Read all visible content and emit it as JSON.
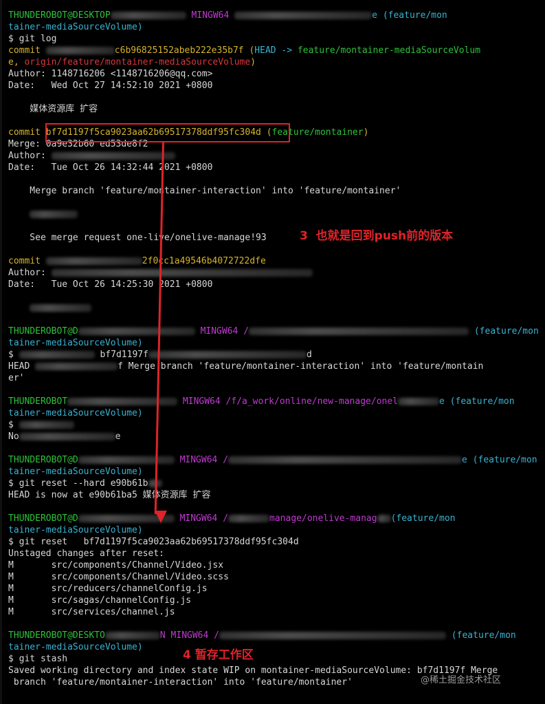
{
  "terminal": {
    "lines": [
      [
        {
          "t": "THUNDEROBOT@DESKTOP",
          "c": "green"
        },
        {
          "blur": 110
        },
        {
          "t": " MINGW64 ",
          "c": "magenta"
        },
        {
          "blur": 200
        },
        {
          "t": "e (feature/mon",
          "c": "cyan"
        }
      ],
      [
        {
          "t": "tainer-mediaSourceVolume)",
          "c": "cyan"
        }
      ],
      [
        {
          "t": "$ git log",
          "c": "white"
        }
      ],
      [
        {
          "t": "commit ",
          "c": "yellow"
        },
        {
          "blur": 100
        },
        {
          "t": "c6b96825152abeb222e35b7f (",
          "c": "yellow"
        },
        {
          "t": "HEAD -> ",
          "c": "cyan"
        },
        {
          "t": "feature/montainer-mediaSourceVolum",
          "c": "green"
        }
      ],
      [
        {
          "t": "e, ",
          "c": "yellow"
        },
        {
          "t": "origin/feature/montainer-mediaSourceVolume",
          "c": "red"
        },
        {
          "t": ")",
          "c": "yellow"
        }
      ],
      [
        {
          "t": "Author: 1148716206 <1148716206@qq.com>",
          "c": "white"
        }
      ],
      [
        {
          "t": "Date:   Wed Oct 27 14:52:10 2021 +0800",
          "c": "white"
        }
      ],
      [
        {
          "t": "",
          "c": "white"
        }
      ],
      [
        {
          "t": "    媒体资源库 扩容",
          "c": "white"
        }
      ],
      [
        {
          "t": "",
          "c": "white"
        }
      ],
      [
        {
          "t": "commit ",
          "c": "yellow"
        },
        {
          "t": "bf7d1197f5ca9023aa62b69517378ddf95fc304d (",
          "c": "yellow"
        },
        {
          "t": "feature/montainer",
          "c": "green"
        },
        {
          "t": ")",
          "c": "yellow"
        }
      ],
      [
        {
          "t": "Merge: 0a9e32b60 ed53de8f2",
          "c": "white"
        }
      ],
      [
        {
          "t": "Author: ",
          "c": "white"
        },
        {
          "blur": 180
        }
      ],
      [
        {
          "t": "Date:   Tue Oct 26 14:32:44 2021 +0800",
          "c": "white"
        }
      ],
      [
        {
          "t": "",
          "c": "white"
        }
      ],
      [
        {
          "t": "    Merge branch 'feature/montainer-interaction' into 'feature/montainer'",
          "c": "white"
        }
      ],
      [
        {
          "t": "",
          "c": "white"
        }
      ],
      [
        {
          "t": "    ",
          "c": "white"
        },
        {
          "blur": 70
        }
      ],
      [
        {
          "t": "",
          "c": "white"
        }
      ],
      [
        {
          "t": "    See merge request one-live/onelive-manage!93",
          "c": "white"
        }
      ],
      [
        {
          "t": "",
          "c": "white"
        }
      ],
      [
        {
          "t": "commit ",
          "c": "yellow"
        },
        {
          "blur": 140
        },
        {
          "t": "2f0cc1a49546b4072722dfe",
          "c": "yellow"
        }
      ],
      [
        {
          "t": "Author: ",
          "c": "white"
        },
        {
          "blur": 380
        }
      ],
      [
        {
          "t": "Date:   Tue Oct 26 14:25:30 2021 +0800",
          "c": "white"
        }
      ],
      [
        {
          "t": "",
          "c": "white"
        }
      ],
      [
        {
          "t": "    ",
          "c": "white"
        },
        {
          "blur": 90
        }
      ],
      [
        {
          "t": "",
          "c": "white"
        }
      ],
      [
        {
          "t": "THUNDEROBOT@D",
          "c": "green"
        },
        {
          "blur": 170
        },
        {
          "t": " MINGW64 /",
          "c": "magenta"
        },
        {
          "blur": 320
        },
        {
          "t": " (feature/mon",
          "c": "cyan"
        }
      ],
      [
        {
          "t": "tainer-mediaSourceVolume)",
          "c": "cyan"
        }
      ],
      [
        {
          "t": "$ ",
          "c": "white"
        },
        {
          "blur": 110
        },
        {
          "t": " bf7d1197f",
          "c": "white"
        },
        {
          "blur": 230
        },
        {
          "t": "d",
          "c": "white"
        }
      ],
      [
        {
          "t": "HEAD ",
          "c": "white"
        },
        {
          "blur": 120
        },
        {
          "t": "f Merge branch 'feature/montainer-interaction' into 'feature/montain",
          "c": "white"
        }
      ],
      [
        {
          "t": "er'",
          "c": "white"
        }
      ],
      [
        {
          "t": "",
          "c": "white"
        }
      ],
      [
        {
          "t": "THUNDEROBOT",
          "c": "green"
        },
        {
          "blur": 160
        },
        {
          "t": " MINGW64 /",
          "c": "magenta"
        },
        {
          "t": "f/a_work/online/new-manage/onel",
          "c": "magenta"
        },
        {
          "blur": 60
        },
        {
          "t": "e (feature/mon",
          "c": "cyan"
        }
      ],
      [
        {
          "t": "tainer-mediaSourceVolume)",
          "c": "cyan"
        }
      ],
      [
        {
          "t": "$ ",
          "c": "white"
        },
        {
          "blur": 80
        }
      ],
      [
        {
          "t": "No",
          "c": "white"
        },
        {
          "blur": 140
        },
        {
          "t": "e",
          "c": "white"
        }
      ],
      [
        {
          "t": "",
          "c": "white"
        }
      ],
      [
        {
          "t": "THUNDEROBOT@D",
          "c": "green"
        },
        {
          "blur": 140
        },
        {
          "t": " MINGW64 /",
          "c": "magenta"
        },
        {
          "blur": 340
        },
        {
          "t": "e (feature/mon",
          "c": "cyan"
        }
      ],
      [
        {
          "t": "tainer-mediaSourceVolume)",
          "c": "cyan"
        }
      ],
      [
        {
          "t": "$ git reset --hard e90b61b",
          "c": "white"
        },
        {
          "blur": 20
        }
      ],
      [
        {
          "t": "HEAD is now at e90b61ba5 媒体资源库 扩容",
          "c": "white"
        }
      ],
      [
        {
          "t": "",
          "c": "white"
        }
      ],
      [
        {
          "t": "THUNDEROBOT@D",
          "c": "green"
        },
        {
          "blur": 140
        },
        {
          "t": " MINGW64 /",
          "c": "magenta"
        },
        {
          "blur": 60
        },
        {
          "t": "manage/onelive-manag",
          "c": "magenta"
        },
        {
          "blur": 20
        },
        {
          "t": "(feature/mon",
          "c": "cyan"
        }
      ],
      [
        {
          "t": "tainer-mediaSourceVolume)",
          "c": "cyan"
        }
      ],
      [
        {
          "t": "$ git reset   bf7d1197f5ca9023aa62b69517378ddf95fc304d",
          "c": "white"
        }
      ],
      [
        {
          "t": "Unstaged changes after reset:",
          "c": "white"
        }
      ],
      [
        {
          "t": "M       src/components/Channel/Video.jsx",
          "c": "white"
        }
      ],
      [
        {
          "t": "M       src/components/Channel/Video.scss",
          "c": "white"
        }
      ],
      [
        {
          "t": "M       src/reducers/channelConfig.js",
          "c": "white"
        }
      ],
      [
        {
          "t": "M       src/sagas/channelConfig.js",
          "c": "white"
        }
      ],
      [
        {
          "t": "M       src/services/channel.js",
          "c": "white"
        }
      ],
      [
        {
          "t": "",
          "c": "white"
        }
      ],
      [
        {
          "t": "THUNDEROBOT@DESKTO",
          "c": "green"
        },
        {
          "blur": 80
        },
        {
          "t": "N MINGW64 /",
          "c": "magenta"
        },
        {
          "blur": 330
        },
        {
          "t": " (feature/mon",
          "c": "cyan"
        }
      ],
      [
        {
          "t": "tainer-mediaSourceVolume)",
          "c": "cyan"
        }
      ],
      [
        {
          "t": "$ git stash",
          "c": "white"
        }
      ],
      [
        {
          "t": "Saved working directory and index state WIP on montainer-mediaSourceVolume: bf7d1197f Merge",
          "c": "white"
        }
      ],
      [
        {
          "t": " branch 'feature/montainer-interaction' into 'feature/montainer'",
          "c": "white"
        }
      ]
    ]
  },
  "annotations": {
    "note3": "3  也就是回到push前的版本",
    "note4": "4 暂存工作区"
  },
  "watermark": "@稀土掘金技术社区",
  "colors": {
    "green": "#2ec23a",
    "magenta": "#c13ad3",
    "yellow": "#d6b52c",
    "cyan": "#3ab3d2",
    "red": "#d9373c",
    "white": "#d8d8d8",
    "annotation": "#e0232a"
  }
}
